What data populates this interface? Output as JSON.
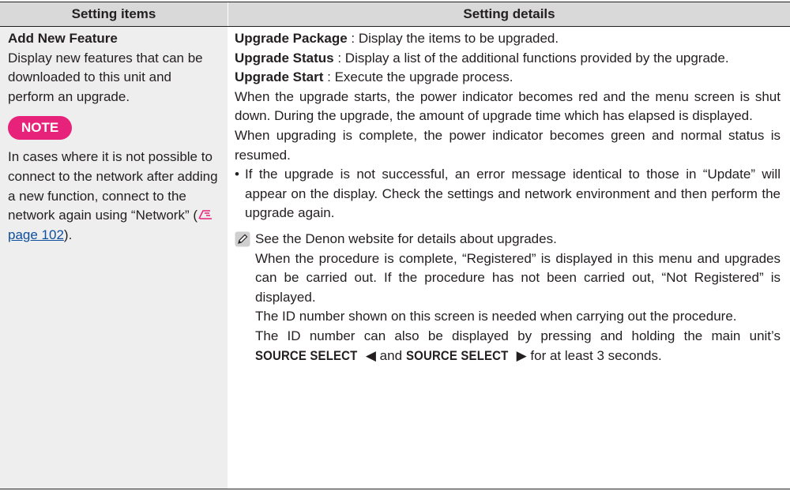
{
  "table": {
    "header": {
      "col1": "Setting items",
      "col2": "Setting details"
    },
    "left": {
      "title": "Add New Feature",
      "description": "Display new features that can be downloaded to this unit and perform an upgrade.",
      "note_label": "NOTE",
      "note_text_before": "In cases where it is not possible to connect to the network after adding a new function, connect to the network again using “Network” (",
      "note_link": "page 102",
      "note_text_after": ")."
    },
    "right": {
      "upgrade_package_label": "Upgrade Package",
      "upgrade_package_text": " : Display the items to be upgraded.",
      "upgrade_status_label": "Upgrade Status",
      "upgrade_status_text": " : Display a list of the additional functions provided by the upgrade.",
      "upgrade_start_label": "Upgrade Start",
      "upgrade_start_text": " : Execute the upgrade process.",
      "para1": "When the upgrade starts, the power indicator becomes red and the menu screen is shut down. During the upgrade, the amount of upgrade time which has elapsed is displayed.",
      "para2": "When upgrading is complete, the power indicator becomes green and normal status is resumed.",
      "bullet": "If the upgrade is not successful, an error message identical to those in “Update” will appear on the display. Check the settings and network environment and then perform the upgrade again.",
      "memo1": "See the Denon website for details about upgrades.",
      "memo2": "When the procedure is complete, “Registered” is displayed in this menu and upgrades can be carried out. If the procedure has not been carried out, “Not Registered” is displayed.",
      "memo3": "The ID number shown on this screen is needed when carrying out the procedure.",
      "memo4_a": "The ID number can also be displayed by pressing and holding the main unit’s ",
      "memo4_key1": "SOURCE SELECT",
      "memo4_mid": " and ",
      "memo4_key2": "SOURCE SELECT",
      "memo4_b": " for at least 3 seconds."
    },
    "colors": {
      "note_badge": "#e6227a",
      "link": "#0d4e9e",
      "header_bg": "#d9d9d9",
      "left_bg": "#eeeeee"
    }
  }
}
